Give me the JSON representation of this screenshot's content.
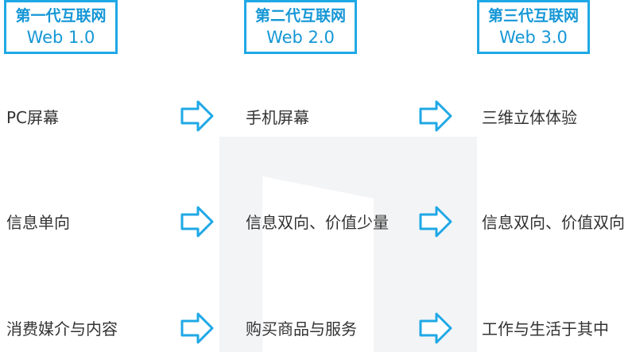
{
  "headers": [
    {
      "line1": "第一代互联网",
      "line2": "Web 1.0"
    },
    {
      "line1": "第二代互联网",
      "line2": "Web 2.0"
    },
    {
      "line1": "第三代互联网",
      "line2": "Web 3.0"
    }
  ],
  "rows": [
    [
      "PC屏幕",
      "手机屏幕",
      "三维立体体验"
    ],
    [
      "信息单向",
      "信息双向、价值少量",
      "信息双向、价值双向"
    ],
    [
      "消费媒介与内容",
      "购买商品与服务",
      "工作与生活于其中"
    ]
  ],
  "colors": {
    "accent": "#1fa8e6",
    "header_text": "#1597d6",
    "body_text": "#333333"
  },
  "icons": {
    "arrow": "outlined-right-arrow-icon"
  }
}
